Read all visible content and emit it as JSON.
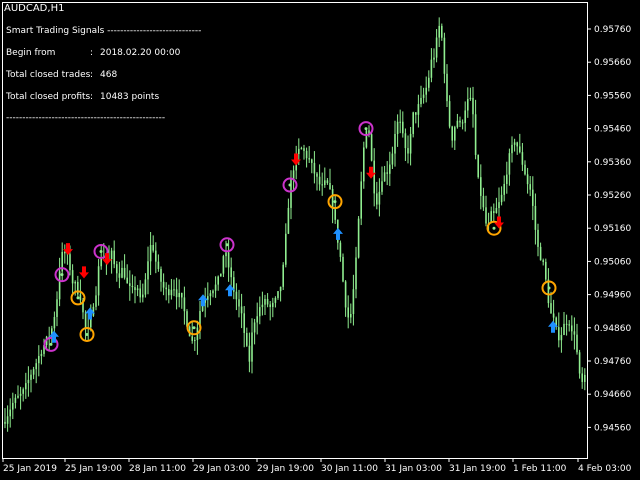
{
  "symbol_title": "AUDCAD,H1",
  "panel": {
    "title": "Smart Trading Signals -----------------------------",
    "rows": [
      {
        "label": "Begin from",
        "sep": ":",
        "value": "2018.02.20 00:00"
      },
      {
        "label": "Total closed trades",
        "sep": ":",
        "value": "468"
      },
      {
        "label": "Total closed profits",
        "sep": ":",
        "value": "10483 points"
      }
    ],
    "divider": "-------------------------------------------------"
  },
  "colors": {
    "background": "#000000",
    "frame": "#ffffff",
    "candle": "#90ee90",
    "buy_arrow": "#1e90ff",
    "sell_arrow": "#ff0000",
    "entry_circle": "#cc33cc",
    "exit_circle": "#ffa500"
  },
  "chart_data": {
    "type": "candlestick",
    "y_ticks": [
      "0.95760",
      "0.95660",
      "0.95560",
      "0.95460",
      "0.95360",
      "0.95260",
      "0.95160",
      "0.95060",
      "0.94960",
      "0.94860",
      "0.94760",
      "0.94660",
      "0.94560"
    ],
    "x_ticks": [
      "25 Jan 2019",
      "25 Jan 19:00",
      "28 Jan 11:00",
      "29 Jan 03:00",
      "29 Jan 19:00",
      "30 Jan 11:00",
      "31 Jan 03:00",
      "31 Jan 19:00",
      "1 Feb 11:00",
      "4 Feb 03:00"
    ],
    "ylim": [
      0.945,
      0.9584
    ],
    "close_points": [
      [
        0,
        0.9455
      ],
      [
        6,
        0.9459
      ],
      [
        12,
        0.9463
      ],
      [
        18,
        0.9465
      ],
      [
        22,
        0.9466
      ],
      [
        27,
        0.9469
      ],
      [
        32,
        0.9473
      ],
      [
        37,
        0.9476
      ],
      [
        41,
        0.9479
      ],
      [
        46,
        0.9482
      ],
      [
        50,
        0.9484
      ],
      [
        53,
        0.9487
      ],
      [
        57,
        0.9495
      ],
      [
        60,
        0.9505
      ],
      [
        63,
        0.9509
      ],
      [
        66,
        0.9508
      ],
      [
        69,
        0.9506
      ],
      [
        72,
        0.95
      ],
      [
        75,
        0.9499
      ],
      [
        78,
        0.9497
      ],
      [
        81,
        0.9495
      ],
      [
        84,
        0.9488
      ],
      [
        87,
        0.9484
      ],
      [
        90,
        0.9487
      ],
      [
        93,
        0.9493
      ],
      [
        96,
        0.9497
      ],
      [
        99,
        0.9505
      ],
      [
        102,
        0.9509
      ],
      [
        105,
        0.9507
      ],
      [
        108,
        0.9505
      ],
      [
        111,
        0.9509
      ],
      [
        115,
        0.9504
      ],
      [
        119,
        0.9502
      ],
      [
        123,
        0.9504
      ],
      [
        128,
        0.9498
      ],
      [
        133,
        0.9497
      ],
      [
        137,
        0.9499
      ],
      [
        141,
        0.9493
      ],
      [
        145,
        0.9499
      ],
      [
        149,
        0.9509
      ],
      [
        152,
        0.9512
      ],
      [
        155,
        0.9507
      ],
      [
        158,
        0.9503
      ],
      [
        161,
        0.95
      ],
      [
        165,
        0.9497
      ],
      [
        169,
        0.9497
      ],
      [
        173,
        0.9499
      ],
      [
        177,
        0.9496
      ],
      [
        181,
        0.9495
      ],
      [
        185,
        0.949
      ],
      [
        189,
        0.9485
      ],
      [
        193,
        0.9481
      ],
      [
        197,
        0.9486
      ],
      [
        201,
        0.9493
      ],
      [
        205,
        0.9495
      ],
      [
        209,
        0.9497
      ],
      [
        213,
        0.9498
      ],
      [
        217,
        0.9499
      ],
      [
        221,
        0.9503
      ],
      [
        224,
        0.9509
      ],
      [
        227,
        0.9507
      ],
      [
        230,
        0.9502
      ],
      [
        234,
        0.9497
      ],
      [
        238,
        0.9493
      ],
      [
        242,
        0.9489
      ],
      [
        246,
        0.9481
      ],
      [
        249,
        0.9475
      ],
      [
        252,
        0.9484
      ],
      [
        255,
        0.9489
      ],
      [
        258,
        0.9491
      ],
      [
        262,
        0.9493
      ],
      [
        266,
        0.9494
      ],
      [
        270,
        0.9492
      ],
      [
        274,
        0.9493
      ],
      [
        278,
        0.9496
      ],
      [
        282,
        0.95
      ],
      [
        285,
        0.951
      ],
      [
        288,
        0.9522
      ],
      [
        291,
        0.953
      ],
      [
        294,
        0.9535
      ],
      [
        298,
        0.9539
      ],
      [
        302,
        0.954
      ],
      [
        306,
        0.9538
      ],
      [
        310,
        0.9536
      ],
      [
        314,
        0.9533
      ],
      [
        318,
        0.953
      ],
      [
        322,
        0.9528
      ],
      [
        326,
        0.953
      ],
      [
        329,
        0.9528
      ],
      [
        332,
        0.9524
      ],
      [
        335,
        0.9518
      ],
      [
        338,
        0.9512
      ],
      [
        341,
        0.9506
      ],
      [
        344,
        0.9497
      ],
      [
        347,
        0.949
      ],
      [
        350,
        0.9488
      ],
      [
        353,
        0.9496
      ],
      [
        356,
        0.9506
      ],
      [
        359,
        0.952
      ],
      [
        362,
        0.9533
      ],
      [
        365,
        0.9545
      ],
      [
        368,
        0.9548
      ],
      [
        371,
        0.9538
      ],
      [
        374,
        0.9528
      ],
      [
        377,
        0.9524
      ],
      [
        380,
        0.9528
      ],
      [
        383,
        0.9533
      ],
      [
        386,
        0.9532
      ],
      [
        389,
        0.9535
      ],
      [
        392,
        0.9538
      ],
      [
        395,
        0.9545
      ],
      [
        398,
        0.9548
      ],
      [
        401,
        0.9547
      ],
      [
        404,
        0.9541
      ],
      [
        407,
        0.9538
      ],
      [
        410,
        0.9542
      ],
      [
        413,
        0.955
      ],
      [
        416,
        0.9551
      ],
      [
        419,
        0.9553
      ],
      [
        422,
        0.9555
      ],
      [
        425,
        0.9557
      ],
      [
        428,
        0.956
      ],
      [
        431,
        0.9566
      ],
      [
        434,
        0.9568
      ],
      [
        437,
        0.9573
      ],
      [
        440,
        0.9578
      ],
      [
        443,
        0.957
      ],
      [
        446,
        0.9556
      ],
      [
        449,
        0.9548
      ],
      [
        452,
        0.9543
      ],
      [
        455,
        0.9547
      ],
      [
        458,
        0.9549
      ],
      [
        461,
        0.9546
      ],
      [
        464,
        0.9551
      ],
      [
        467,
        0.9554
      ],
      [
        470,
        0.9555
      ],
      [
        473,
        0.955
      ],
      [
        476,
        0.9536
      ],
      [
        479,
        0.9528
      ],
      [
        482,
        0.9525
      ],
      [
        485,
        0.9518
      ],
      [
        488,
        0.9516
      ],
      [
        491,
        0.952
      ],
      [
        494,
        0.952
      ],
      [
        497,
        0.9522
      ],
      [
        500,
        0.9524
      ],
      [
        503,
        0.9527
      ],
      [
        506,
        0.9532
      ],
      [
        509,
        0.9537
      ],
      [
        512,
        0.954
      ],
      [
        515,
        0.9543
      ],
      [
        518,
        0.954
      ],
      [
        521,
        0.9537
      ],
      [
        524,
        0.9534
      ],
      [
        527,
        0.953
      ],
      [
        530,
        0.9528
      ],
      [
        533,
        0.9522
      ],
      [
        536,
        0.9514
      ],
      [
        539,
        0.9508
      ],
      [
        542,
        0.9507
      ],
      [
        545,
        0.9502
      ],
      [
        548,
        0.9495
      ],
      [
        551,
        0.949
      ],
      [
        554,
        0.9488
      ],
      [
        557,
        0.9484
      ],
      [
        560,
        0.9483
      ],
      [
        563,
        0.9486
      ],
      [
        566,
        0.9488
      ],
      [
        569,
        0.9488
      ],
      [
        572,
        0.9484
      ],
      [
        575,
        0.9485
      ],
      [
        578,
        0.9475
      ],
      [
        581,
        0.9468
      ],
      [
        584,
        0.9471
      ],
      [
        586,
        0.947
      ]
    ],
    "markers": [
      {
        "type": "entry",
        "x": 51,
        "y": 0.9481
      },
      {
        "type": "buy",
        "x": 54,
        "y": 0.9483
      },
      {
        "type": "entry",
        "x": 62,
        "y": 0.9502
      },
      {
        "type": "sell",
        "x": 68,
        "y": 0.951
      },
      {
        "type": "exit",
        "x": 78,
        "y": 0.9495
      },
      {
        "type": "sell",
        "x": 84,
        "y": 0.9503
      },
      {
        "type": "buy",
        "x": 90,
        "y": 0.949
      },
      {
        "type": "exit",
        "x": 87,
        "y": 0.9484
      },
      {
        "type": "entry",
        "x": 101,
        "y": 0.9509
      },
      {
        "type": "sell",
        "x": 107,
        "y": 0.9507
      },
      {
        "type": "buy",
        "x": 203,
        "y": 0.9494
      },
      {
        "type": "exit",
        "x": 194,
        "y": 0.9486
      },
      {
        "type": "entry",
        "x": 227,
        "y": 0.9511
      },
      {
        "type": "buy",
        "x": 230,
        "y": 0.9497
      },
      {
        "type": "entry",
        "x": 290,
        "y": 0.9529
      },
      {
        "type": "sell",
        "x": 296,
        "y": 0.9537
      },
      {
        "type": "exit",
        "x": 335,
        "y": 0.9524
      },
      {
        "type": "buy",
        "x": 338,
        "y": 0.9514
      },
      {
        "type": "entry",
        "x": 366,
        "y": 0.9546
      },
      {
        "type": "sell",
        "x": 371,
        "y": 0.9533
      },
      {
        "type": "exit",
        "x": 494,
        "y": 0.9516
      },
      {
        "type": "sell",
        "x": 499,
        "y": 0.9518
      },
      {
        "type": "exit",
        "x": 549,
        "y": 0.9498
      },
      {
        "type": "buy",
        "x": 553,
        "y": 0.9486
      }
    ]
  }
}
